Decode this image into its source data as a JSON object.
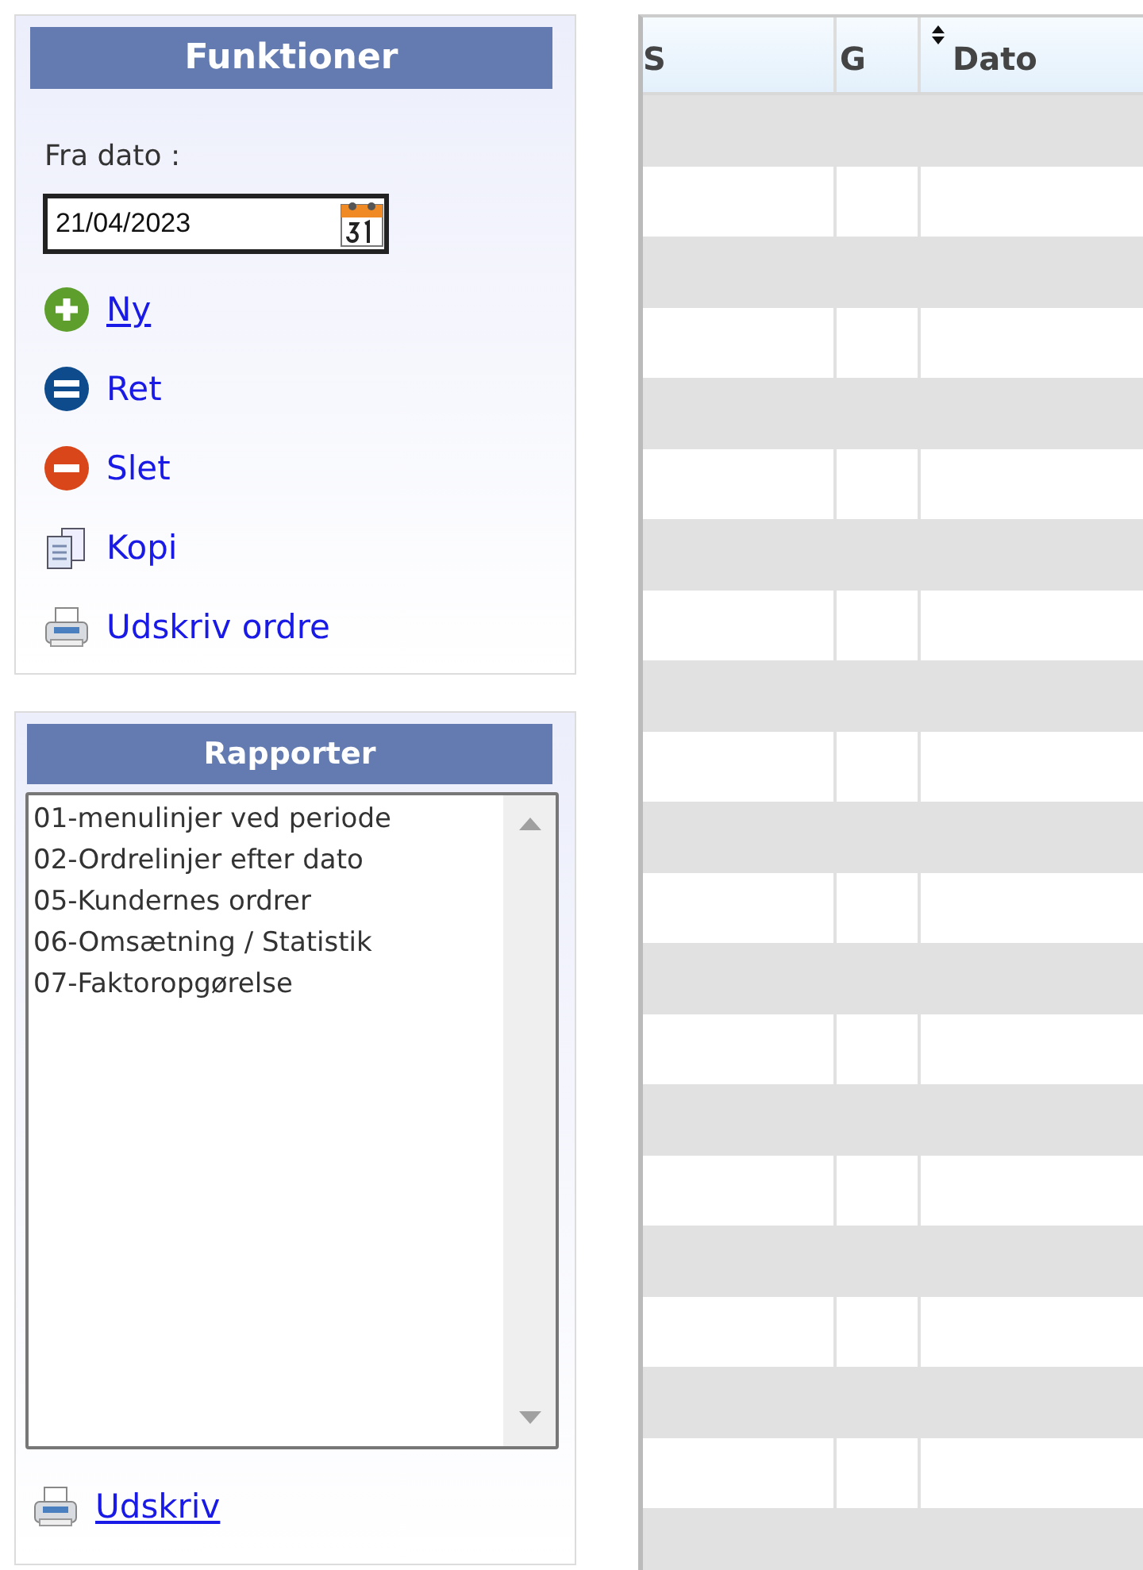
{
  "functions": {
    "title": "Funktioner",
    "date_label": "Fra dato :",
    "date_value": "21/04/2023",
    "links": [
      {
        "label": "Ny",
        "kind": "add",
        "underlined": true
      },
      {
        "label": "Ret",
        "kind": "edit",
        "underlined": false
      },
      {
        "label": "Slet",
        "kind": "delete",
        "underlined": false
      },
      {
        "label": "Kopi",
        "kind": "copy",
        "underlined": false
      },
      {
        "label": "Udskriv ordre",
        "kind": "print",
        "underlined": false
      }
    ]
  },
  "reports": {
    "title": "Rapporter",
    "items": [
      {
        "label": "01-menulinjer ved periode",
        "selected": false
      },
      {
        "label": "02-Ordrelinjer efter dato",
        "selected": false
      },
      {
        "label": "05-Kundernes ordrer",
        "selected": false
      },
      {
        "label": "06-Omsætning / Statistik",
        "selected": false
      },
      {
        "label": "07-Faktoropgørelse",
        "selected": false
      }
    ],
    "print_link": {
      "label": "Udskriv",
      "underlined": true
    }
  },
  "table": {
    "columns": [
      {
        "label": "S",
        "sortable": false
      },
      {
        "label": "G",
        "sortable": false
      },
      {
        "label": "Dato",
        "sortable": true
      }
    ]
  }
}
